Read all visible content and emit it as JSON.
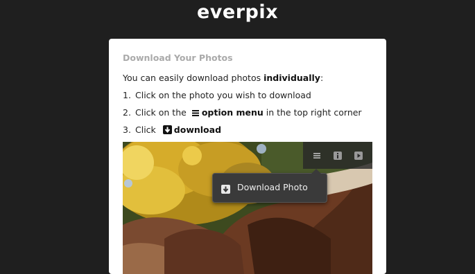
{
  "brand": {
    "logo": "everpix"
  },
  "card": {
    "title": "Download Your Photos",
    "intro_text": "You can easily download photos ",
    "intro_bold": "individually",
    "intro_end": ":",
    "steps": [
      {
        "number": "1.",
        "text": "Click on the photo you wish to download"
      },
      {
        "number": "2.",
        "text": "Click on the",
        "bold": "option menu",
        "text_after": " in the top right corner"
      },
      {
        "number": "3.",
        "text": "Click",
        "bold": "download"
      }
    ]
  },
  "photo_menu": {
    "download_label": "Download Photo",
    "toolbar_icons": [
      "menu-icon",
      "info-icon",
      "play-icon"
    ]
  },
  "colors": {
    "page_bg": "#1f1f1f",
    "card_bg": "#ffffff",
    "title_gray": "#aaaaaa",
    "menu_bg": "#3a3a3a"
  }
}
